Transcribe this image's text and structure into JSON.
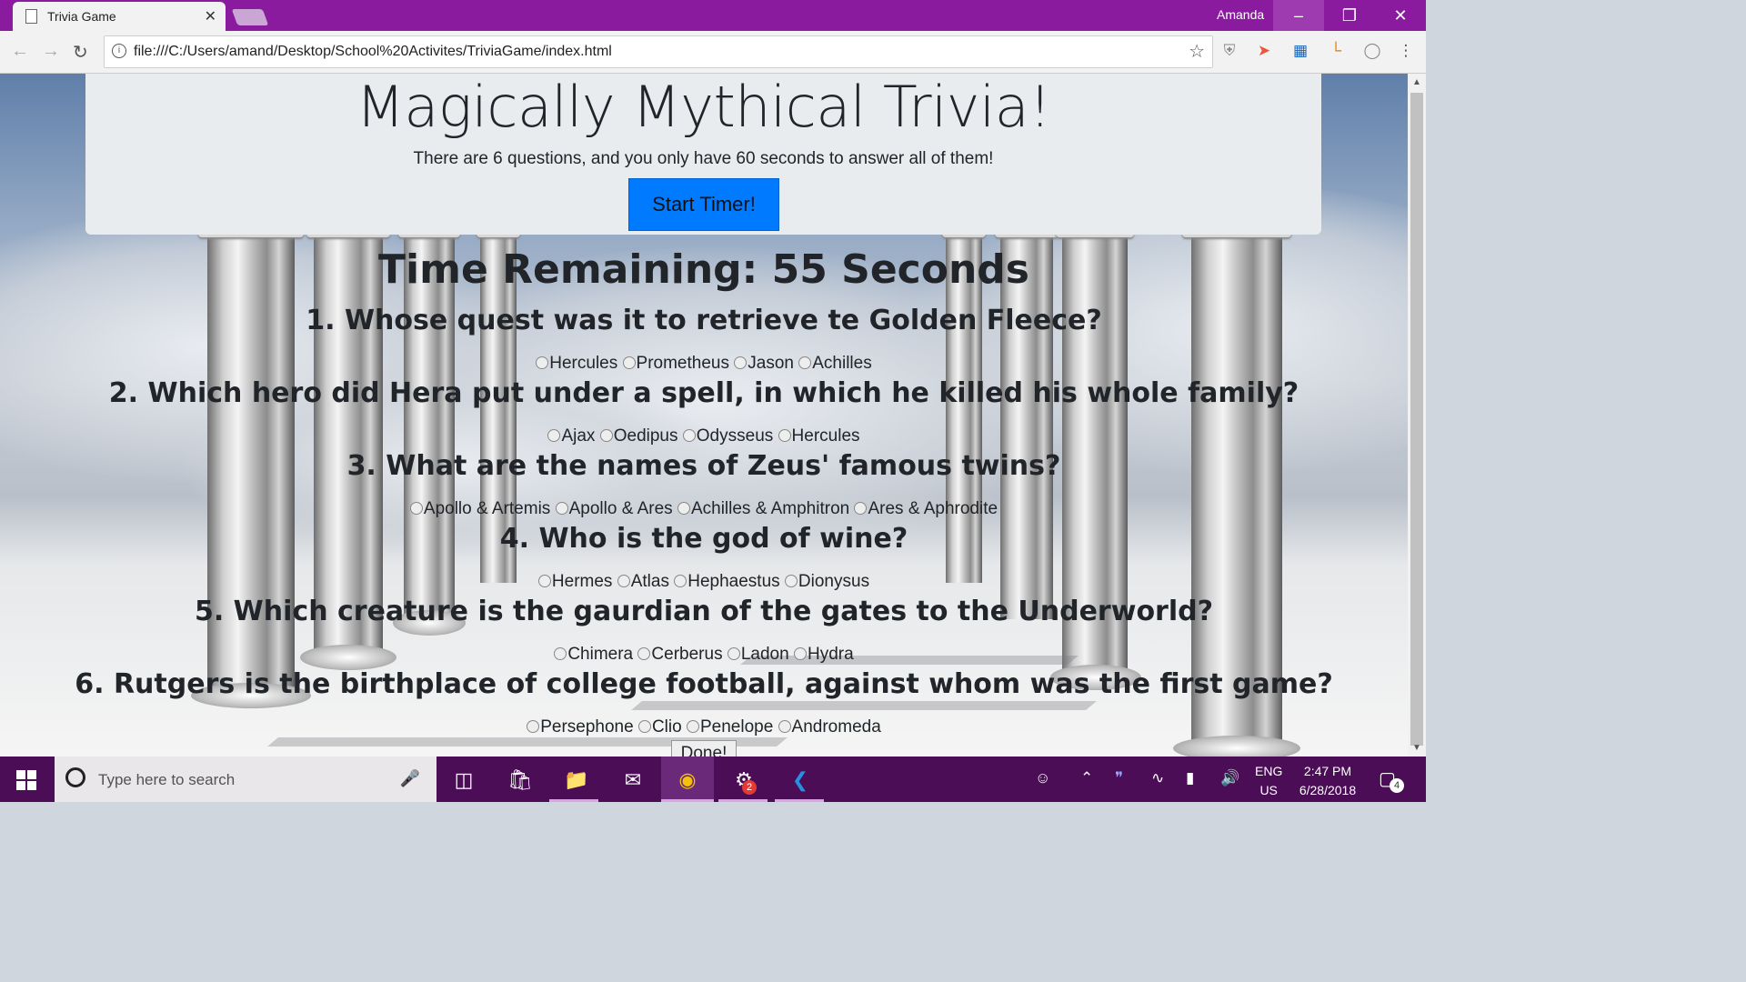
{
  "browser": {
    "tab_title": "Trivia Game",
    "tab_close": "✕",
    "user_name": "Amanda",
    "url": "file:///C:/Users/amand/Desktop/School%20Activites/TriviaGame/index.html"
  },
  "page": {
    "title": "Magically Mythical Trivia!",
    "subtitle": "There are 6 questions, and you only have 60 seconds to answer all of them!",
    "start_label": "Start Timer!",
    "timer": "Time Remaining: 55 Seconds",
    "done_label": "Done!"
  },
  "questions": [
    {
      "text": "1. Whose quest was it to retrieve te Golden Fleece?",
      "options": [
        "Hercules",
        "Prometheus",
        "Jason",
        "Achilles"
      ]
    },
    {
      "text": "2. Which hero did Hera put under a spell, in which he killed his whole family?",
      "options": [
        "Ajax",
        "Oedipus",
        "Odysseus",
        "Hercules"
      ]
    },
    {
      "text": "3. What are the names of Zeus' famous twins?",
      "options": [
        "Apollo & Artemis",
        "Apollo & Ares",
        "Achilles & Amphitron",
        "Ares & Aphrodite"
      ]
    },
    {
      "text": "4. Who is the god of wine?",
      "options": [
        "Hermes",
        "Atlas",
        "Hephaestus",
        "Dionysus"
      ]
    },
    {
      "text": "5. Which creature is the gaurdian of the gates to the Underworld?",
      "options": [
        "Chimera",
        "Cerberus",
        "Ladon",
        "Hydra"
      ]
    },
    {
      "text": "6. Rutgers is the birthplace of college football, against whom was the first game?",
      "options": [
        "Persephone",
        "Clio",
        "Penelope",
        "Andromeda"
      ]
    }
  ],
  "taskbar": {
    "search_placeholder": "Type here to search",
    "lang_line1": "ENG",
    "lang_line2": "US",
    "time": "2:47 PM",
    "date": "6/28/2018",
    "notification_count": "4",
    "app_badge": "2"
  },
  "colors": {
    "titlebar": "#8a1a9e",
    "start_button": "#007bff",
    "taskbar": "#4a0d56"
  }
}
